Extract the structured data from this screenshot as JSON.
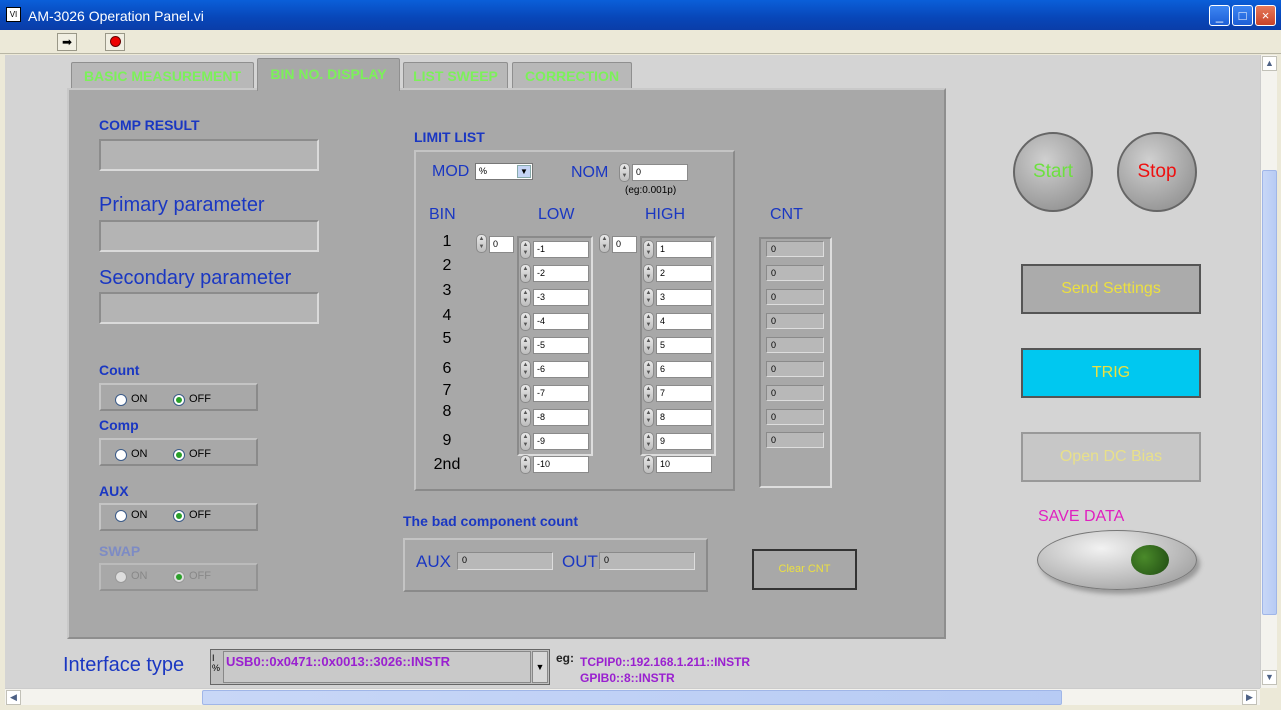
{
  "window": {
    "title": "AM-3026 Operation Panel.vi",
    "icon": "labview-vi-icon",
    "minimize": "_",
    "maximize": "□",
    "close": "×"
  },
  "toolbar": {
    "run": "➡",
    "stop": "stop-icon"
  },
  "tabs": [
    "BASIC MEASUREMENT",
    "BIN NO. DISPLAY",
    "LIST SWEEP",
    "CORRECTION"
  ],
  "active_tab": 1,
  "left": {
    "comp_result_label": "COMP RESULT",
    "comp_result_value": "",
    "primary_label": "Primary parameter",
    "primary_value": "",
    "secondary_label": "Secondary parameter",
    "secondary_value": "",
    "count": {
      "label": "Count",
      "on": "ON",
      "off": "OFF",
      "selected": "OFF"
    },
    "comp": {
      "label": "Comp",
      "on": "ON",
      "off": "OFF",
      "selected": "OFF"
    },
    "aux": {
      "label": "AUX",
      "on": "ON",
      "off": "OFF",
      "selected": "OFF"
    },
    "swap": {
      "label": "SWAP",
      "on": "ON",
      "off": "OFF",
      "selected": "OFF",
      "disabled": true
    }
  },
  "limit_list": {
    "title": "LIMIT LIST",
    "mod_label": "MOD",
    "mod_value": "%",
    "nom_label": "NOM",
    "nom_value": "0",
    "nom_hint": "(eg:0.001p)",
    "bin_header": "BIN",
    "low_header": "LOW",
    "high_header": "HIGH",
    "cnt_header": "CNT",
    "low_index": "0",
    "high_index": "0",
    "bins": [
      "1",
      "2",
      "3",
      "4",
      "5",
      "6",
      "7",
      "8",
      "9",
      "2nd"
    ],
    "low": [
      "-1",
      "-2",
      "-3",
      "-4",
      "-5",
      "-6",
      "-7",
      "-8",
      "-9",
      "-10"
    ],
    "high": [
      "1",
      "2",
      "3",
      "4",
      "5",
      "6",
      "7",
      "8",
      "9",
      "10"
    ],
    "cnt": [
      "0",
      "0",
      "0",
      "0",
      "0",
      "0",
      "0",
      "0",
      "0"
    ]
  },
  "bad_count": {
    "title": "The bad component count",
    "aux_label": "AUX",
    "aux_value": "0",
    "out_label": "OUT",
    "out_value": "0",
    "clear_label": "Clear CNT"
  },
  "right": {
    "start_label": "Start",
    "stop_label": "Stop",
    "send_settings_label": "Send Settings",
    "trig_label": "TRIG",
    "open_dc_bias_label": "Open DC Bias",
    "save_data_label": "SAVE DATA"
  },
  "interface": {
    "label": "Interface type",
    "value": "USB0::0x0471::0x0013::3026::INSTR",
    "prefix": "I/O",
    "eg_label": "eg:",
    "eg_line1": "TCPIP0::192.168.1.211::INSTR",
    "eg_line2": "GPIB0::8::INSTR"
  },
  "colors": {
    "tab_text": "#7cf05a",
    "label_blue": "#1a37c2",
    "trig_bg": "#00c8f0",
    "save_label": "#e020c0",
    "interface_text": "#9a20d0"
  }
}
